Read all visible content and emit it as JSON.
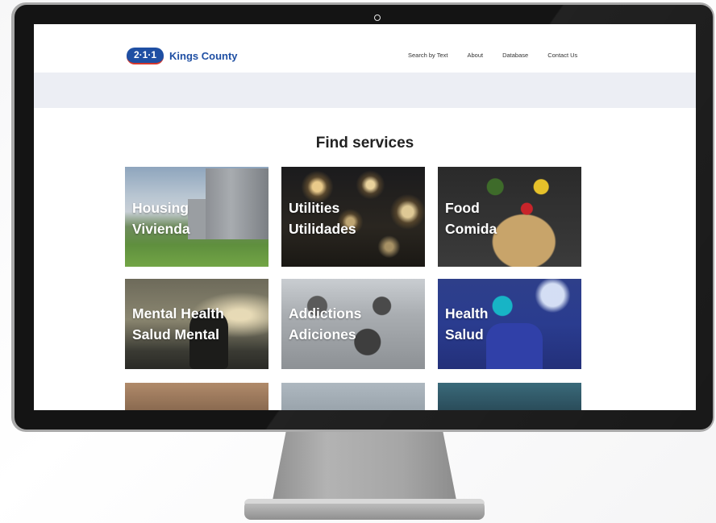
{
  "header": {
    "logo_mark": "2·1·1",
    "logo_name": "Kings County",
    "nav": [
      "Search by Text",
      "About",
      "Database",
      "Contact Us"
    ]
  },
  "main": {
    "section_title": "Find services",
    "tiles": [
      {
        "line1": "Housing",
        "line2": "Vivienda"
      },
      {
        "line1": "Utilities",
        "line2": "Utilidades"
      },
      {
        "line1": "Food",
        "line2": "Comida"
      },
      {
        "line1": "Mental Health",
        "line2": "Salud Mental"
      },
      {
        "line1": "Addictions",
        "line2": "Adiciones"
      },
      {
        "line1": "Health",
        "line2": "Salud"
      }
    ]
  },
  "colors": {
    "brand_blue": "#1f4fa3",
    "brand_red": "#d7372c",
    "hero_band": "#eceef4"
  },
  "icons": {
    "camera": "webcam-icon"
  }
}
